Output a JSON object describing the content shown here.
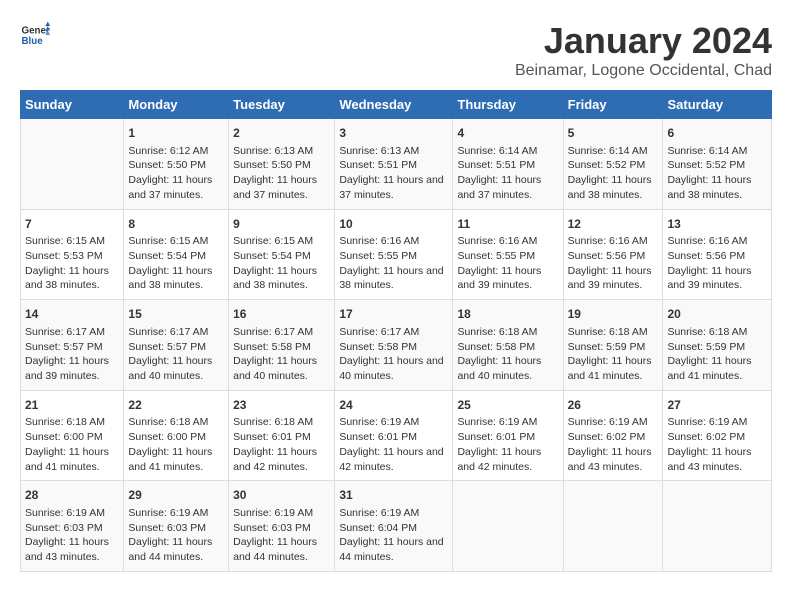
{
  "header": {
    "logo_line1": "General",
    "logo_line2": "Blue",
    "title": "January 2024",
    "subtitle": "Beinamar, Logone Occidental, Chad"
  },
  "columns": [
    "Sunday",
    "Monday",
    "Tuesday",
    "Wednesday",
    "Thursday",
    "Friday",
    "Saturday"
  ],
  "weeks": [
    [
      {
        "day": "",
        "sunrise": "",
        "sunset": "",
        "daylight": ""
      },
      {
        "day": "1",
        "sunrise": "Sunrise: 6:12 AM",
        "sunset": "Sunset: 5:50 PM",
        "daylight": "Daylight: 11 hours and 37 minutes."
      },
      {
        "day": "2",
        "sunrise": "Sunrise: 6:13 AM",
        "sunset": "Sunset: 5:50 PM",
        "daylight": "Daylight: 11 hours and 37 minutes."
      },
      {
        "day": "3",
        "sunrise": "Sunrise: 6:13 AM",
        "sunset": "Sunset: 5:51 PM",
        "daylight": "Daylight: 11 hours and 37 minutes."
      },
      {
        "day": "4",
        "sunrise": "Sunrise: 6:14 AM",
        "sunset": "Sunset: 5:51 PM",
        "daylight": "Daylight: 11 hours and 37 minutes."
      },
      {
        "day": "5",
        "sunrise": "Sunrise: 6:14 AM",
        "sunset": "Sunset: 5:52 PM",
        "daylight": "Daylight: 11 hours and 38 minutes."
      },
      {
        "day": "6",
        "sunrise": "Sunrise: 6:14 AM",
        "sunset": "Sunset: 5:52 PM",
        "daylight": "Daylight: 11 hours and 38 minutes."
      }
    ],
    [
      {
        "day": "7",
        "sunrise": "Sunrise: 6:15 AM",
        "sunset": "Sunset: 5:53 PM",
        "daylight": "Daylight: 11 hours and 38 minutes."
      },
      {
        "day": "8",
        "sunrise": "Sunrise: 6:15 AM",
        "sunset": "Sunset: 5:54 PM",
        "daylight": "Daylight: 11 hours and 38 minutes."
      },
      {
        "day": "9",
        "sunrise": "Sunrise: 6:15 AM",
        "sunset": "Sunset: 5:54 PM",
        "daylight": "Daylight: 11 hours and 38 minutes."
      },
      {
        "day": "10",
        "sunrise": "Sunrise: 6:16 AM",
        "sunset": "Sunset: 5:55 PM",
        "daylight": "Daylight: 11 hours and 38 minutes."
      },
      {
        "day": "11",
        "sunrise": "Sunrise: 6:16 AM",
        "sunset": "Sunset: 5:55 PM",
        "daylight": "Daylight: 11 hours and 39 minutes."
      },
      {
        "day": "12",
        "sunrise": "Sunrise: 6:16 AM",
        "sunset": "Sunset: 5:56 PM",
        "daylight": "Daylight: 11 hours and 39 minutes."
      },
      {
        "day": "13",
        "sunrise": "Sunrise: 6:16 AM",
        "sunset": "Sunset: 5:56 PM",
        "daylight": "Daylight: 11 hours and 39 minutes."
      }
    ],
    [
      {
        "day": "14",
        "sunrise": "Sunrise: 6:17 AM",
        "sunset": "Sunset: 5:57 PM",
        "daylight": "Daylight: 11 hours and 39 minutes."
      },
      {
        "day": "15",
        "sunrise": "Sunrise: 6:17 AM",
        "sunset": "Sunset: 5:57 PM",
        "daylight": "Daylight: 11 hours and 40 minutes."
      },
      {
        "day": "16",
        "sunrise": "Sunrise: 6:17 AM",
        "sunset": "Sunset: 5:58 PM",
        "daylight": "Daylight: 11 hours and 40 minutes."
      },
      {
        "day": "17",
        "sunrise": "Sunrise: 6:17 AM",
        "sunset": "Sunset: 5:58 PM",
        "daylight": "Daylight: 11 hours and 40 minutes."
      },
      {
        "day": "18",
        "sunrise": "Sunrise: 6:18 AM",
        "sunset": "Sunset: 5:58 PM",
        "daylight": "Daylight: 11 hours and 40 minutes."
      },
      {
        "day": "19",
        "sunrise": "Sunrise: 6:18 AM",
        "sunset": "Sunset: 5:59 PM",
        "daylight": "Daylight: 11 hours and 41 minutes."
      },
      {
        "day": "20",
        "sunrise": "Sunrise: 6:18 AM",
        "sunset": "Sunset: 5:59 PM",
        "daylight": "Daylight: 11 hours and 41 minutes."
      }
    ],
    [
      {
        "day": "21",
        "sunrise": "Sunrise: 6:18 AM",
        "sunset": "Sunset: 6:00 PM",
        "daylight": "Daylight: 11 hours and 41 minutes."
      },
      {
        "day": "22",
        "sunrise": "Sunrise: 6:18 AM",
        "sunset": "Sunset: 6:00 PM",
        "daylight": "Daylight: 11 hours and 41 minutes."
      },
      {
        "day": "23",
        "sunrise": "Sunrise: 6:18 AM",
        "sunset": "Sunset: 6:01 PM",
        "daylight": "Daylight: 11 hours and 42 minutes."
      },
      {
        "day": "24",
        "sunrise": "Sunrise: 6:19 AM",
        "sunset": "Sunset: 6:01 PM",
        "daylight": "Daylight: 11 hours and 42 minutes."
      },
      {
        "day": "25",
        "sunrise": "Sunrise: 6:19 AM",
        "sunset": "Sunset: 6:01 PM",
        "daylight": "Daylight: 11 hours and 42 minutes."
      },
      {
        "day": "26",
        "sunrise": "Sunrise: 6:19 AM",
        "sunset": "Sunset: 6:02 PM",
        "daylight": "Daylight: 11 hours and 43 minutes."
      },
      {
        "day": "27",
        "sunrise": "Sunrise: 6:19 AM",
        "sunset": "Sunset: 6:02 PM",
        "daylight": "Daylight: 11 hours and 43 minutes."
      }
    ],
    [
      {
        "day": "28",
        "sunrise": "Sunrise: 6:19 AM",
        "sunset": "Sunset: 6:03 PM",
        "daylight": "Daylight: 11 hours and 43 minutes."
      },
      {
        "day": "29",
        "sunrise": "Sunrise: 6:19 AM",
        "sunset": "Sunset: 6:03 PM",
        "daylight": "Daylight: 11 hours and 44 minutes."
      },
      {
        "day": "30",
        "sunrise": "Sunrise: 6:19 AM",
        "sunset": "Sunset: 6:03 PM",
        "daylight": "Daylight: 11 hours and 44 minutes."
      },
      {
        "day": "31",
        "sunrise": "Sunrise: 6:19 AM",
        "sunset": "Sunset: 6:04 PM",
        "daylight": "Daylight: 11 hours and 44 minutes."
      },
      {
        "day": "",
        "sunrise": "",
        "sunset": "",
        "daylight": ""
      },
      {
        "day": "",
        "sunrise": "",
        "sunset": "",
        "daylight": ""
      },
      {
        "day": "",
        "sunrise": "",
        "sunset": "",
        "daylight": ""
      }
    ]
  ]
}
